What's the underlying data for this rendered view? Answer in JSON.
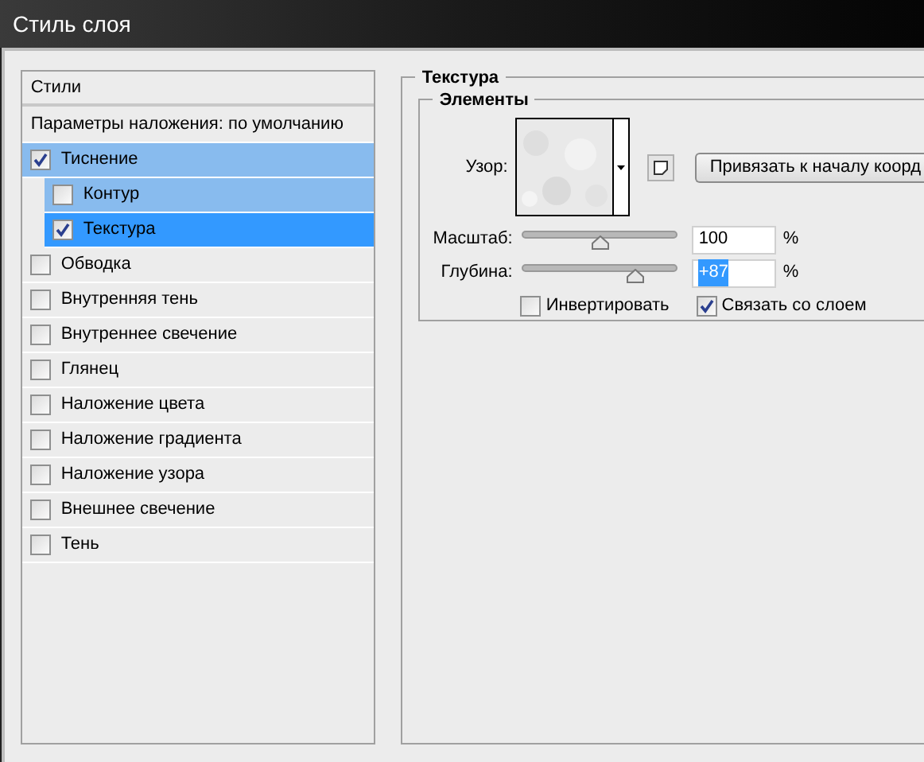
{
  "window": {
    "title": "Стиль слоя"
  },
  "styles_panel": {
    "header": "Стили",
    "blending_options": "Параметры наложения: по умолчанию",
    "items": [
      {
        "label": "Тиснение",
        "checked": true,
        "selected": false,
        "children": [
          {
            "label": "Контур",
            "checked": false,
            "selected": false
          },
          {
            "label": "Текстура",
            "checked": true,
            "selected": true
          }
        ]
      },
      {
        "label": "Обводка",
        "checked": false,
        "selected": false
      },
      {
        "label": "Внутренняя тень",
        "checked": false,
        "selected": false
      },
      {
        "label": "Внутреннее свечение",
        "checked": false,
        "selected": false
      },
      {
        "label": "Глянец",
        "checked": false,
        "selected": false
      },
      {
        "label": "Наложение цвета",
        "checked": false,
        "selected": false
      },
      {
        "label": "Наложение градиента",
        "checked": false,
        "selected": false
      },
      {
        "label": "Наложение узора",
        "checked": false,
        "selected": false
      },
      {
        "label": "Внешнее свечение",
        "checked": false,
        "selected": false
      },
      {
        "label": "Тень",
        "checked": false,
        "selected": false
      }
    ]
  },
  "texture": {
    "title": "Текстура",
    "group": "Элементы",
    "pattern_label": "Узор:",
    "snap_button": "Привязать к началу коорд",
    "sliders": [
      {
        "label": "Масштаб:",
        "value": "100",
        "unit": "%",
        "level": 0.5,
        "value_selected": false
      },
      {
        "label": "Глубина:",
        "value": "+87",
        "unit": "%",
        "level": 0.72,
        "value_selected": true
      }
    ],
    "options": [
      {
        "label": "Инвертировать",
        "checked": false
      },
      {
        "label": "Связать со слоем",
        "checked": true
      }
    ]
  }
}
